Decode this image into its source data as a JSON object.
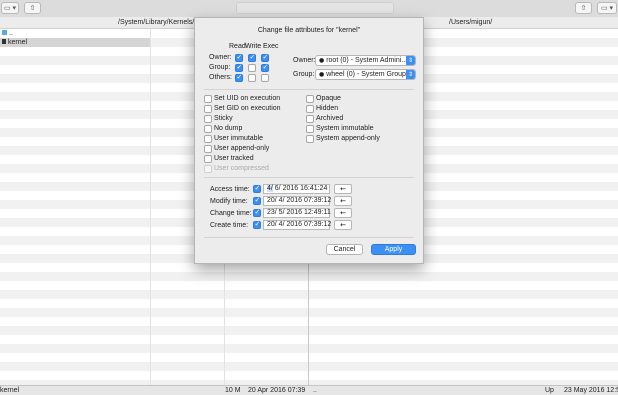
{
  "toolbar": {
    "view_btn": "▭ ▾",
    "share_left": "⇧",
    "share_right": "⇧",
    "tags_right": "▭ ▾"
  },
  "paths": {
    "left": "/System/Library/Kernels/",
    "right": "/Users/migun/"
  },
  "left_files": [
    {
      "name": "..",
      "icon": "folder-icon"
    },
    {
      "name": "kernel",
      "icon": "file-icon"
    }
  ],
  "status": {
    "name": "kernel",
    "size": "10 M",
    "date": "20 Apr 2016 07:39",
    "dots": "..",
    "right_name": "Up",
    "right_date": "23 May 2016 12:51"
  },
  "dialog": {
    "title": "Change file attributes for \"kernel\"",
    "perm_headers": [
      "Read",
      "Write",
      "Exec"
    ],
    "perm_rows": [
      {
        "label": "Owner:",
        "values": [
          true,
          true,
          true
        ]
      },
      {
        "label": "Group:",
        "values": [
          true,
          false,
          true
        ]
      },
      {
        "label": "Others:",
        "values": [
          true,
          false,
          false
        ]
      }
    ],
    "owner_label": "Owner:",
    "owner_value": "root (0) - System Admini...",
    "group_label": "Group:",
    "group_value": "wheel (0) - System Group",
    "flags_left": [
      {
        "label": "Set UID on execution",
        "checked": false
      },
      {
        "label": "Set GID on execution",
        "checked": false
      },
      {
        "label": "Sticky",
        "checked": false
      },
      {
        "label": "No dump",
        "checked": false
      },
      {
        "label": "User immutable",
        "checked": false
      },
      {
        "label": "User append-only",
        "checked": false
      },
      {
        "label": "User tracked",
        "checked": false
      },
      {
        "label": "User compressed",
        "checked": false,
        "disabled": true
      }
    ],
    "flags_right": [
      {
        "label": "Opaque",
        "checked": false
      },
      {
        "label": "Hidden",
        "checked": false
      },
      {
        "label": "Archived",
        "checked": false
      },
      {
        "label": "System immutable",
        "checked": false
      },
      {
        "label": "System append-only",
        "checked": false
      }
    ],
    "times": [
      {
        "label": "Access time:",
        "checked": true,
        "day": "4/",
        "rest": " 6/ 2016 16:41:24",
        "btn": "←"
      },
      {
        "label": "Modify time:",
        "checked": true,
        "day": "20/",
        "rest": " 4/ 2016 07:39:12",
        "btn": "←"
      },
      {
        "label": "Change time:",
        "checked": true,
        "day": "23/",
        "rest": " 5/ 2016 12:49:11",
        "btn": "←"
      },
      {
        "label": "Create time:",
        "checked": true,
        "day": "20/",
        "rest": " 4/ 2016 07:39:12",
        "btn": "←"
      }
    ],
    "cancel_label": "Cancel",
    "apply_label": "Apply"
  },
  "colors": {
    "accent": "#3c8ff5",
    "dialog_bg": "#ececec",
    "toolbar_bg": "#dcdcdc"
  }
}
